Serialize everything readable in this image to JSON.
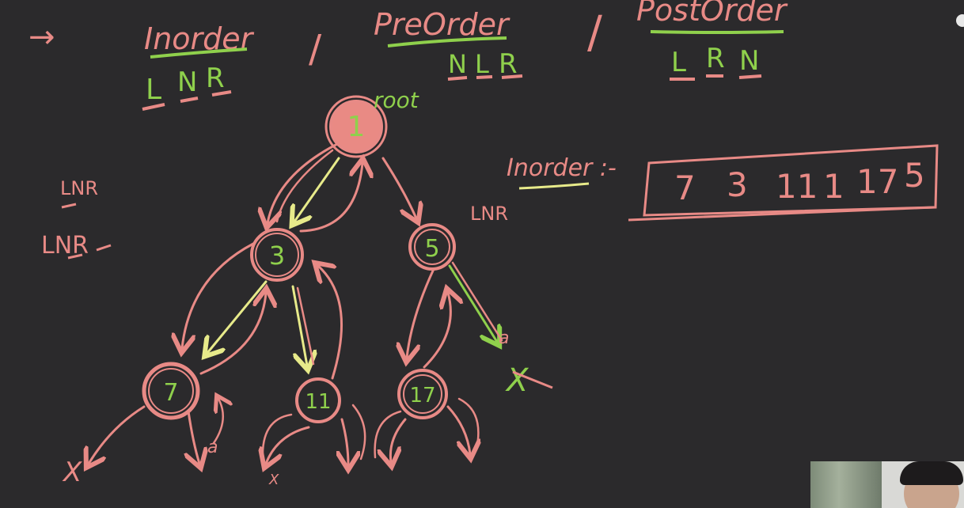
{
  "header": {
    "arrow": "→",
    "inorder": {
      "title": "Inorder",
      "code": [
        "L",
        "N",
        "R"
      ]
    },
    "preorder": {
      "title": "PreOrder",
      "code": [
        "N",
        "L",
        "R"
      ]
    },
    "postorder": {
      "title": "PostOrder",
      "code": [
        "L",
        "R",
        "N"
      ]
    },
    "separator": "/"
  },
  "side_notes": [
    "LNR",
    "LNR"
  ],
  "right_note": "LNR",
  "tree": {
    "root_label": "root",
    "nodes": {
      "root": "1",
      "left": "3",
      "right": "5",
      "left_left": "7",
      "left_right": "11",
      "right_left": "17"
    },
    "null_marks": [
      "X",
      "X",
      "X",
      "X"
    ],
    "null_labels": [
      "a",
      "a"
    ]
  },
  "result": {
    "label": "Inorder :-",
    "sequence": [
      "7",
      "3",
      "11",
      "1",
      "17",
      "5"
    ]
  },
  "colors": {
    "board": "#2b2a2c",
    "pink": "#e88a86",
    "green": "#8fd04c",
    "yellow": "#e7ea8a",
    "node_fill": "#e98a84"
  }
}
